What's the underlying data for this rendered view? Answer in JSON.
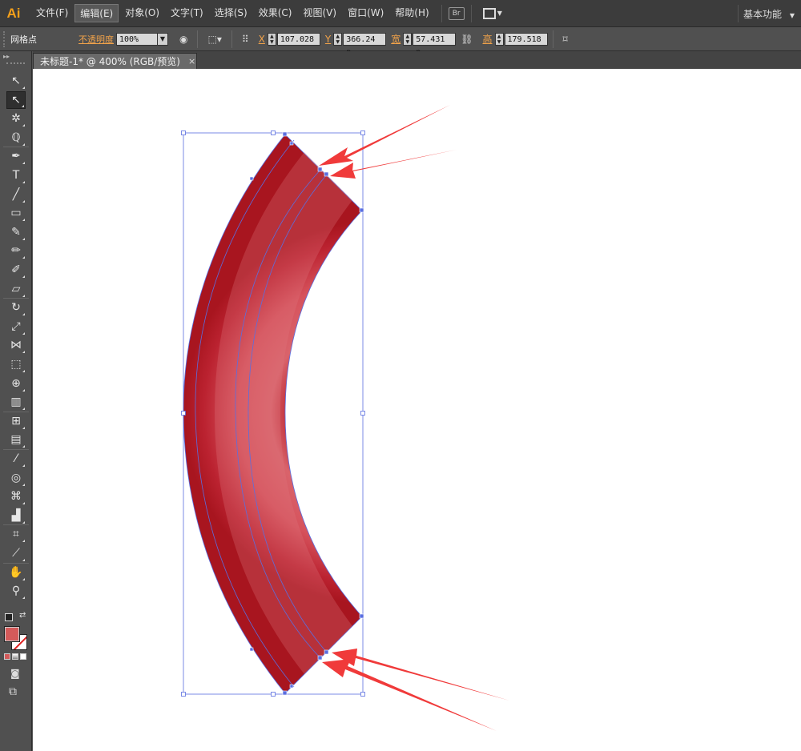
{
  "app": {
    "logo": "Ai"
  },
  "menu": [
    {
      "label": "文件(F)"
    },
    {
      "label": "编辑(E)",
      "active": true
    },
    {
      "label": "对象(O)"
    },
    {
      "label": "文字(T)"
    },
    {
      "label": "选择(S)"
    },
    {
      "label": "效果(C)"
    },
    {
      "label": "视图(V)"
    },
    {
      "label": "窗口(W)"
    },
    {
      "label": "帮助(H)"
    }
  ],
  "menubar_extras": {
    "bridge_label": "Br",
    "workspace": "基本功能"
  },
  "control_bar": {
    "selection_label": "网格点",
    "opacity_label": "不透明度",
    "opacity_value": "100%",
    "x_label": "X",
    "x_value": "107.028",
    "y_label": "Y",
    "y_value": "366.24 p",
    "width_label": "宽",
    "width_value": "57.431 p",
    "height_label": "高",
    "height_value": "179.518"
  },
  "document_tab": {
    "title": "未标题-1* @ 400% (RGB/预览)",
    "close_glyph": "×"
  },
  "tools": [
    {
      "name": "selection-tool",
      "glyph": "↖"
    },
    {
      "name": "direct-selection-tool",
      "glyph": "↖",
      "selected": true
    },
    {
      "name": "magic-wand-tool",
      "glyph": "✲"
    },
    {
      "name": "lasso-tool",
      "glyph": "ℚ"
    },
    {
      "name": "pen-tool",
      "glyph": "✒"
    },
    {
      "name": "type-tool",
      "glyph": "T"
    },
    {
      "name": "line-tool",
      "glyph": "╱"
    },
    {
      "name": "rectangle-tool",
      "glyph": "▭"
    },
    {
      "name": "paintbrush-tool",
      "glyph": "✎"
    },
    {
      "name": "pencil-tool",
      "glyph": "✏"
    },
    {
      "name": "blob-brush-tool",
      "glyph": "✐"
    },
    {
      "name": "eraser-tool",
      "glyph": "▱"
    },
    {
      "name": "rotate-tool",
      "glyph": "↻"
    },
    {
      "name": "scale-tool",
      "glyph": "⤢"
    },
    {
      "name": "width-tool",
      "glyph": "⋈"
    },
    {
      "name": "free-transform-tool",
      "glyph": "⬚"
    },
    {
      "name": "shape-builder-tool",
      "glyph": "⊕"
    },
    {
      "name": "perspective-grid-tool",
      "glyph": "▥"
    },
    {
      "name": "mesh-tool",
      "glyph": "⊞"
    },
    {
      "name": "gradient-tool",
      "glyph": "▤"
    },
    {
      "name": "eyedropper-tool",
      "glyph": "⁄"
    },
    {
      "name": "blend-tool",
      "glyph": "◎"
    },
    {
      "name": "symbol-sprayer-tool",
      "glyph": "⌘"
    },
    {
      "name": "column-graph-tool",
      "glyph": "▟"
    },
    {
      "name": "artboard-tool",
      "glyph": "⌗"
    },
    {
      "name": "slice-tool",
      "glyph": "⟋"
    },
    {
      "name": "hand-tool",
      "glyph": "✋"
    },
    {
      "name": "zoom-tool",
      "glyph": "⚲"
    }
  ],
  "colors": {
    "fill": "#d45a5a",
    "shape_dark": "#b7202a",
    "shape_light": "#dd6b72",
    "selection": "#5a6ee0",
    "arrow": "#f03a3a"
  }
}
